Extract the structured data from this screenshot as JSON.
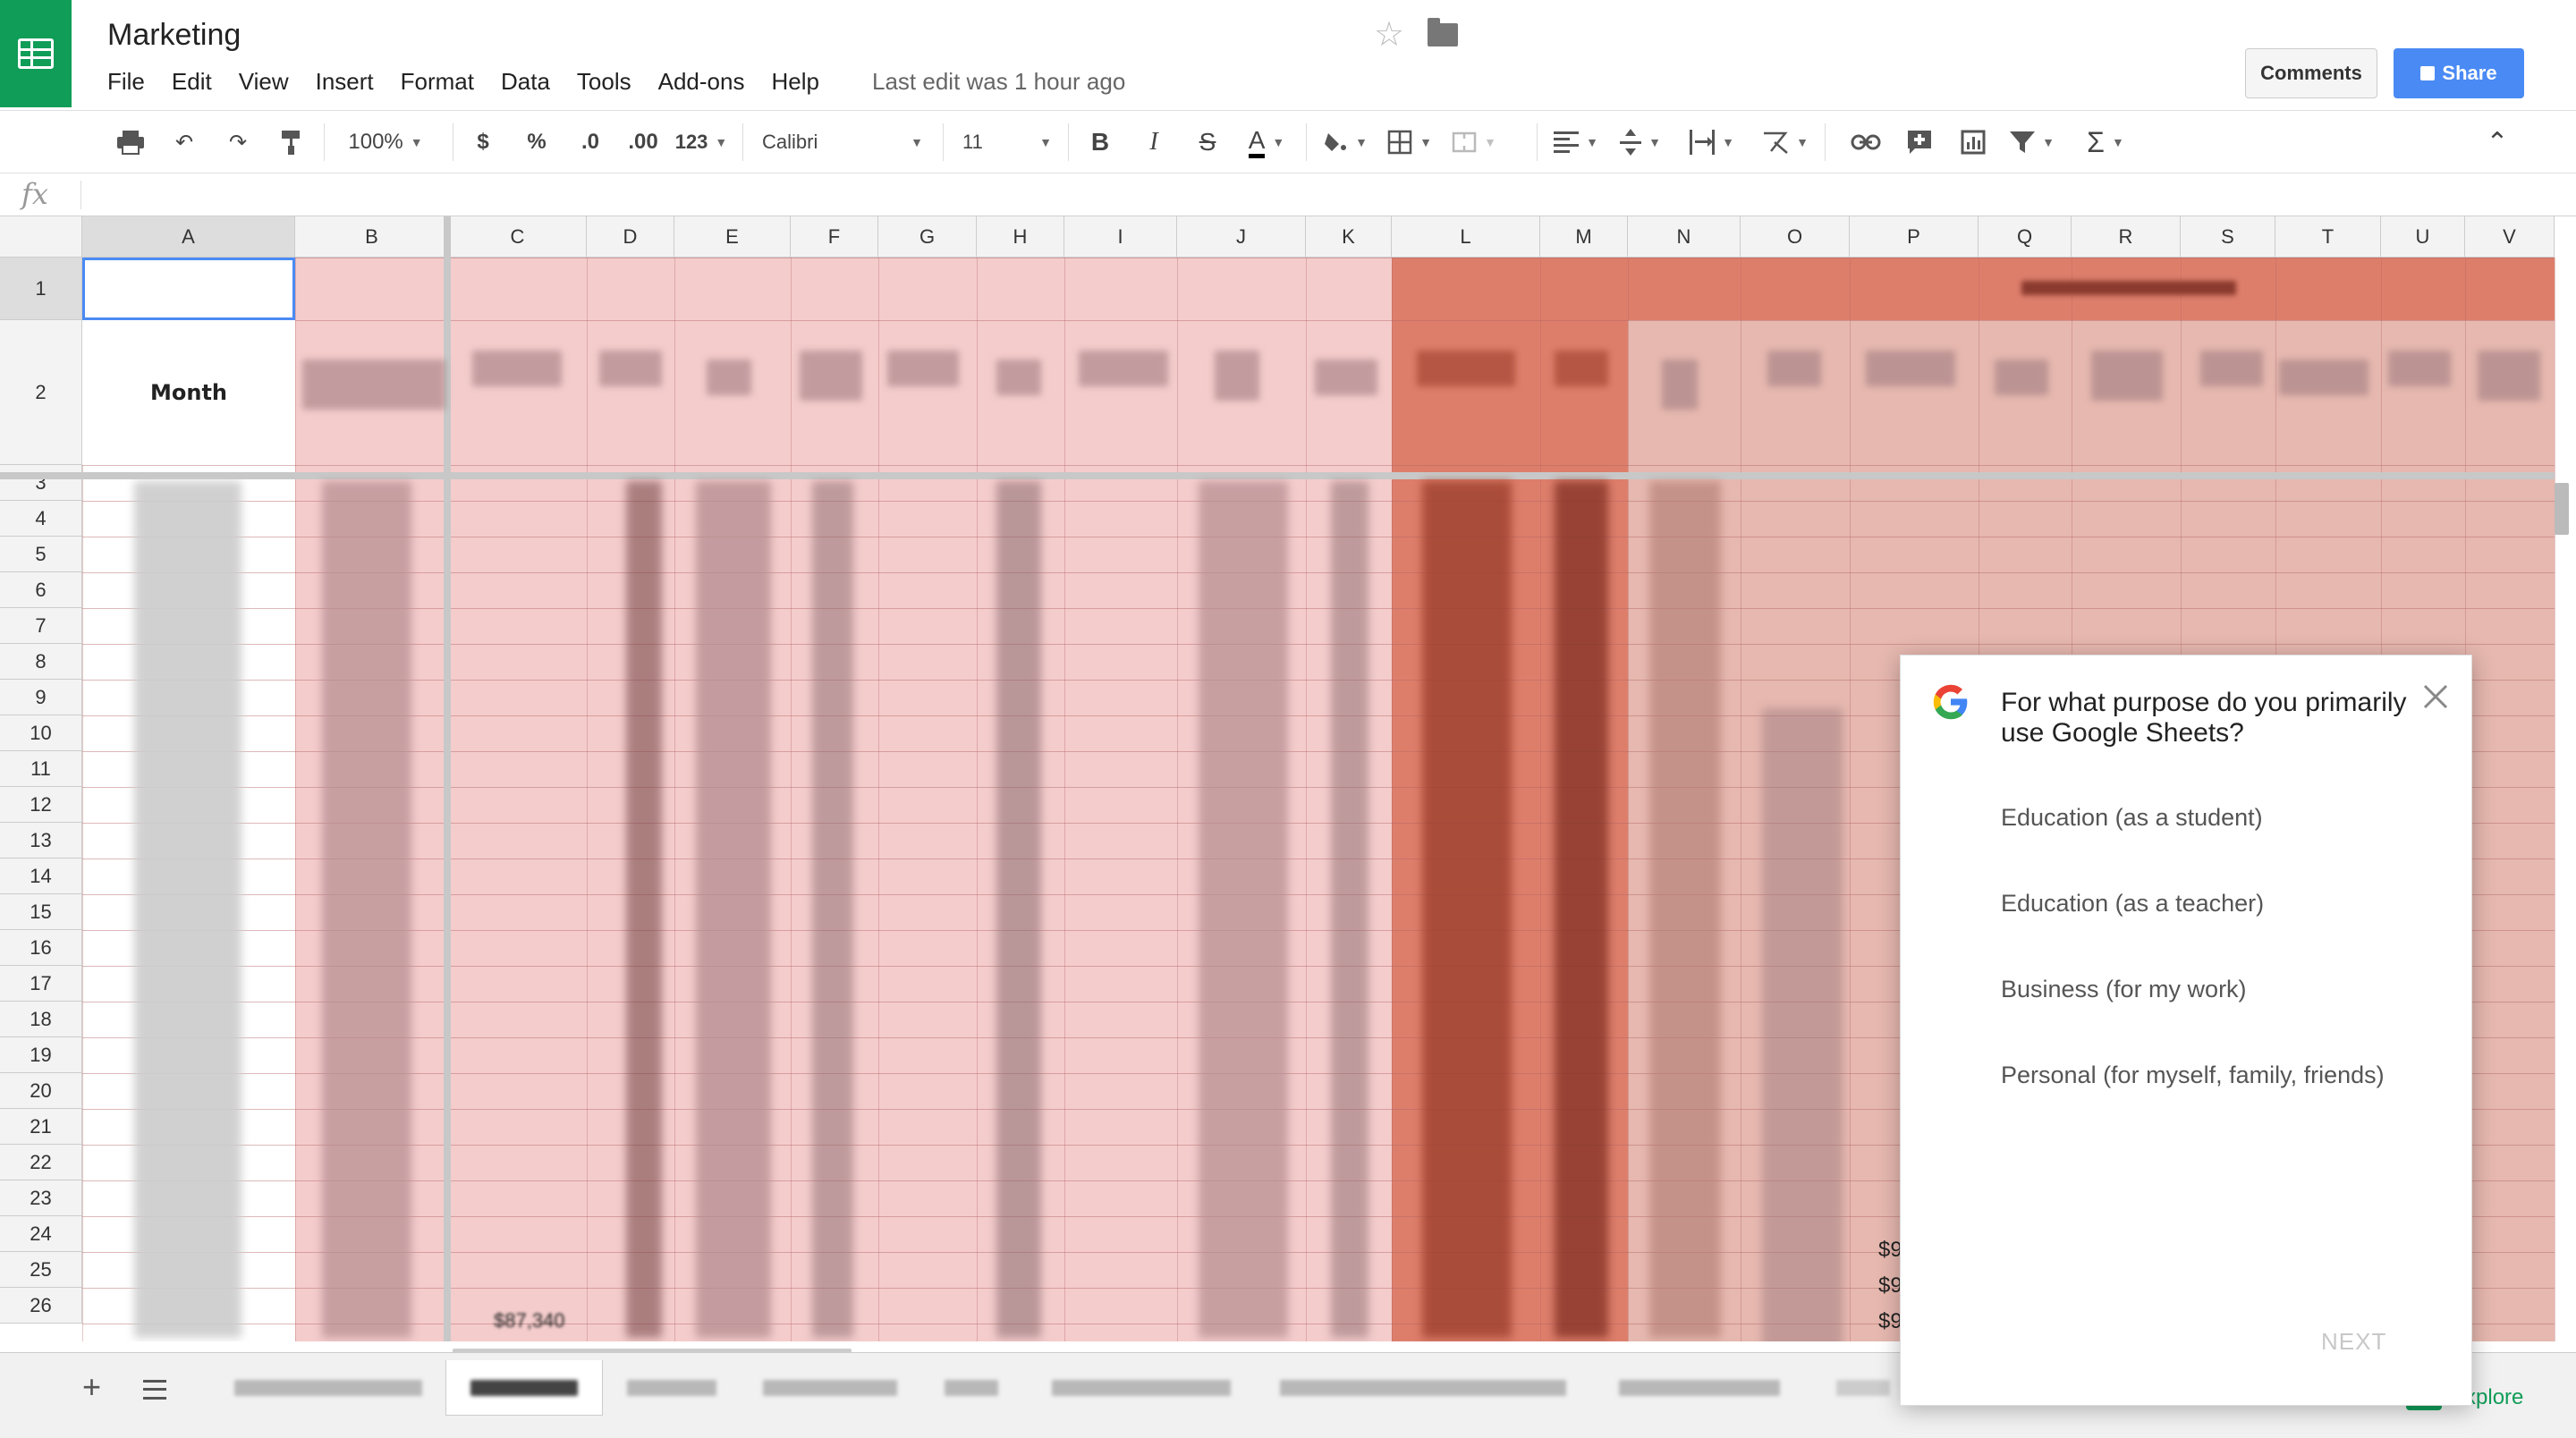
{
  "header": {
    "title": "Marketing",
    "last_edit": "Last edit was 1 hour ago",
    "comments_label": "Comments",
    "share_label": "Share"
  },
  "menu": [
    "File",
    "Edit",
    "View",
    "Insert",
    "Format",
    "Data",
    "Tools",
    "Add-ons",
    "Help"
  ],
  "toolbar": {
    "zoom": "100%",
    "currency": "$",
    "percent": "%",
    "decrease_decimals": ".0",
    "increase_decimals": ".00",
    "more_formats": "123",
    "font": "Calibri",
    "font_size": "11",
    "bold": "B",
    "italic": "I",
    "strike": "S",
    "text_color": "A",
    "functions": "Σ"
  },
  "formula_bar": {
    "icon": "fx",
    "value": ""
  },
  "columns": [
    "A",
    "B",
    "C",
    "D",
    "E",
    "F",
    "G",
    "H",
    "I",
    "J",
    "K",
    "L",
    "M",
    "N",
    "O",
    "P",
    "Q",
    "R",
    "S",
    "T",
    "U",
    "V"
  ],
  "rows": [
    "1",
    "2",
    "3",
    "4",
    "5",
    "6",
    "7",
    "8",
    "9",
    "10",
    "11",
    "12",
    "13",
    "14",
    "15",
    "16",
    "17",
    "18",
    "19",
    "20",
    "21",
    "22",
    "23",
    "24",
    "25",
    "26"
  ],
  "cells": {
    "a2": "Month",
    "c26": "$87,340",
    "p24": "$9",
    "p25": "$9",
    "p26": "$9"
  },
  "colors": {
    "sheets_green": "#0f9d58",
    "share_blue": "#4a8af4",
    "light_pink": "#f4cccc",
    "salmon": "#e6b8af",
    "dark_salmon": "#dd7e6b"
  },
  "survey": {
    "question": "For what purpose do you primarily use Google Sheets?",
    "options": [
      "Education (as a student)",
      "Education (as a teacher)",
      "Business (for my work)",
      "Personal (for myself, family, friends)"
    ],
    "next_label": "NEXT"
  },
  "bottom": {
    "add_sheet": "+",
    "explore_label": "Explore"
  }
}
